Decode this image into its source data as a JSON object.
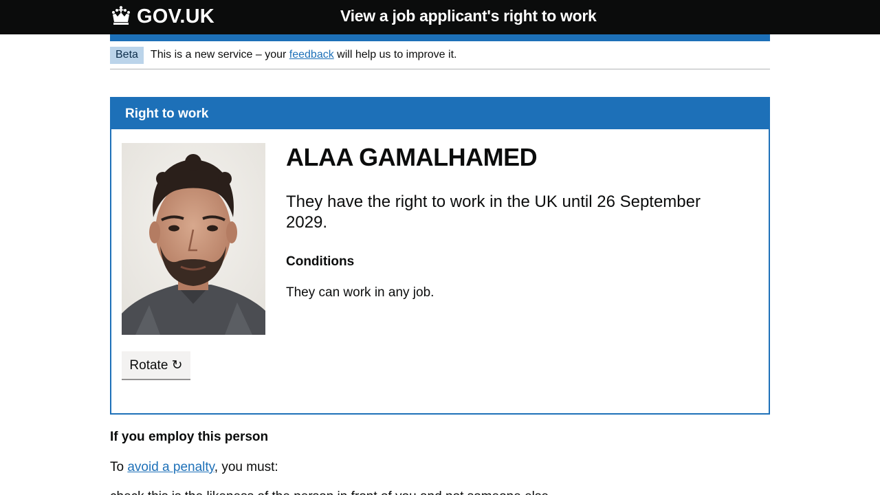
{
  "header": {
    "logo_text": "GOV.UK",
    "crown_icon": "crown-icon",
    "service_name": "View a job applicant's right to work",
    "background_color": "#0b0c0c",
    "stripe_color": "#1d70b8"
  },
  "phase_banner": {
    "tag": "Beta",
    "text_before": "This is a new service – your",
    "link": "feedback",
    "text_after": "will help us to improve it."
  },
  "panel": {
    "title": "Right to work",
    "photo_icon": "applicant-photo",
    "rotate_label": "Rotate ↻",
    "name": "ALAA GAMALHAMED",
    "status": "They have the right to work in the UK until 26 September 2029.",
    "conditions_heading": "Conditions",
    "conditions_text": "They can work in any job."
  },
  "employ": {
    "heading": "If you employ this person",
    "text_before": "To",
    "link": "avoid a penalty",
    "text_after": ", you must:",
    "list_item_partial": "check this is the likeness of the person in front of you and not someone else"
  }
}
